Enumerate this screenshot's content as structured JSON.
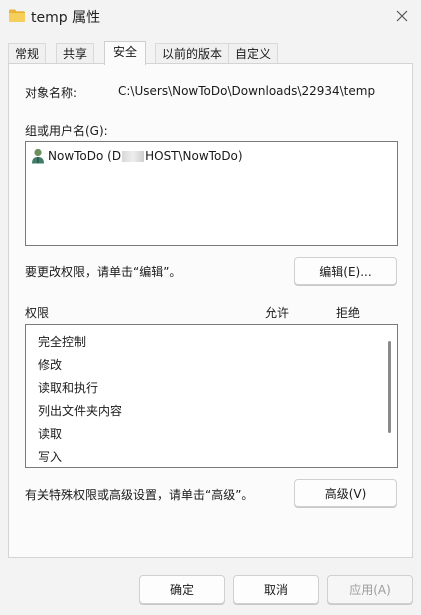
{
  "window": {
    "title": "temp 属性"
  },
  "tabs": [
    {
      "label": "常规"
    },
    {
      "label": "共享"
    },
    {
      "label": "安全"
    },
    {
      "label": "以前的版本"
    },
    {
      "label": "自定义"
    }
  ],
  "security": {
    "object_name_label": "对象名称:",
    "object_name_value": "C:\\Users\\NowToDo\\Downloads\\22934\\temp",
    "group_label": "组或用户名(G):",
    "users": [
      {
        "name_start": "NowToDo (D",
        "name_end": "HOST\\NowToDo)"
      }
    ],
    "edit_hint": "要更改权限，请单击“编辑”。",
    "edit_button": "编辑(E)...",
    "permissions_label": "权限",
    "allow_label": "允许",
    "deny_label": "拒绝",
    "permissions": [
      "完全控制",
      "修改",
      "读取和执行",
      "列出文件夹内容",
      "读取",
      "写入"
    ],
    "advanced_hint": "有关特殊权限或高级设置，请单击“高级”。",
    "advanced_button": "高级(V)"
  },
  "footer": {
    "ok_label": "确定",
    "cancel_label": "取消",
    "apply_label": "应用(A)"
  },
  "icons": {
    "folder": "folder-icon",
    "close": "close-icon",
    "user": "user-icon"
  },
  "colors": {
    "folder": "#f2c84b",
    "user_head": "#3f7d6a"
  }
}
